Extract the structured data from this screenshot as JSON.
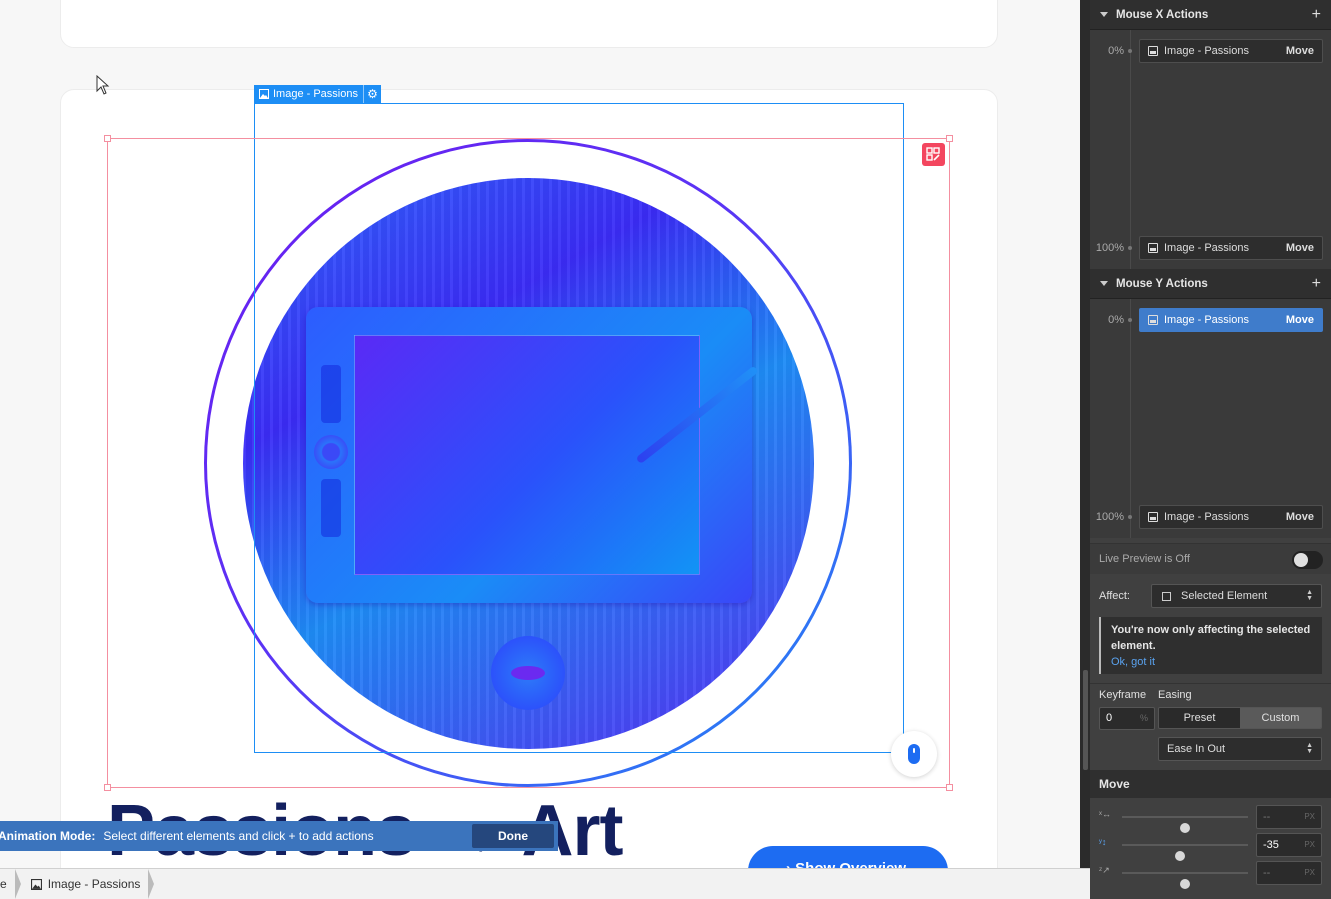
{
  "canvas": {
    "element_tag": "Image - Passions",
    "headline": "Passions → Art",
    "cta_label": "› Show Overview"
  },
  "animation_bar": {
    "mode_label": "Animation Mode:",
    "hint": "Select different elements and click + to add actions",
    "done_label": "Done"
  },
  "breadcrumb": {
    "items": [
      "e",
      "Image - Passions"
    ]
  },
  "panel": {
    "mouse_x": {
      "title": "Mouse X Actions",
      "keyframes": [
        {
          "pct": "0%",
          "label": "Image - Passions",
          "action": "Move"
        },
        {
          "pct": "100%",
          "label": "Image - Passions",
          "action": "Move"
        }
      ]
    },
    "mouse_y": {
      "title": "Mouse Y Actions",
      "keyframes": [
        {
          "pct": "0%",
          "label": "Image - Passions",
          "action": "Move"
        },
        {
          "pct": "100%",
          "label": "Image - Passions",
          "action": "Move"
        }
      ]
    },
    "live_preview": "Live Preview is Off",
    "affect_label": "Affect:",
    "affect_value": "Selected Element",
    "notice_text": "You're now only affecting the selected element.",
    "notice_link": "Ok, got it",
    "keyframe_label": "Keyframe",
    "easing_label": "Easing",
    "keyframe_value": "0",
    "keyframe_unit": "%",
    "preset_label": "Preset",
    "custom_label": "Custom",
    "ease_value": "Ease In Out",
    "move_title": "Move",
    "move_rows": [
      {
        "axis": "X",
        "value": "--",
        "unit": "PX",
        "slider": 0.5
      },
      {
        "axis": "Y",
        "value": "-35",
        "unit": "PX",
        "slider": 0.46
      },
      {
        "axis": "Z",
        "value": "--",
        "unit": "PX",
        "slider": 0.5
      }
    ]
  },
  "colors": {
    "accent": "#1d8ef5",
    "selection": "#f48fa0",
    "active_chip": "#3f7ccb",
    "headline": "#13205f"
  }
}
